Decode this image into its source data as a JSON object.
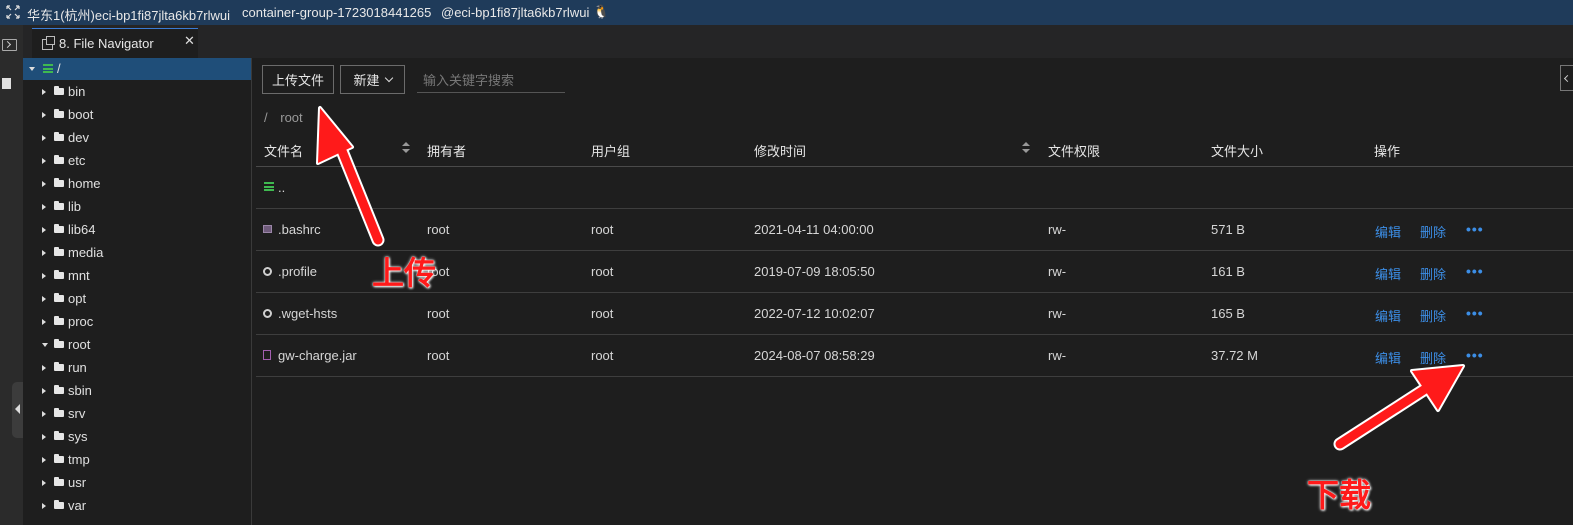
{
  "titlebar": {
    "region": "华东1(杭州)eci-bp1fi87jlta6kb7rlwui",
    "container_group": "container-group-1723018441265",
    "instance": "@eci-bp1fi87jlta6kb7rlwui"
  },
  "tab": {
    "label": "8. File Navigator",
    "close": "✕"
  },
  "tree": {
    "root": "/",
    "items": [
      {
        "name": "bin",
        "open": false
      },
      {
        "name": "boot",
        "open": false
      },
      {
        "name": "dev",
        "open": false
      },
      {
        "name": "etc",
        "open": false
      },
      {
        "name": "home",
        "open": false
      },
      {
        "name": "lib",
        "open": false
      },
      {
        "name": "lib64",
        "open": false
      },
      {
        "name": "media",
        "open": false
      },
      {
        "name": "mnt",
        "open": false
      },
      {
        "name": "opt",
        "open": false
      },
      {
        "name": "proc",
        "open": false
      },
      {
        "name": "root",
        "open": true
      },
      {
        "name": "run",
        "open": false
      },
      {
        "name": "sbin",
        "open": false
      },
      {
        "name": "srv",
        "open": false
      },
      {
        "name": "sys",
        "open": false
      },
      {
        "name": "tmp",
        "open": false
      },
      {
        "name": "usr",
        "open": false
      },
      {
        "name": "var",
        "open": false
      }
    ]
  },
  "toolbar": {
    "upload_label": "上传文件",
    "new_label": "新建",
    "search_placeholder": "输入关键字搜索"
  },
  "breadcrumb": {
    "sep": "/",
    "current": "root"
  },
  "table": {
    "headers": {
      "name": "文件名",
      "owner": "拥有者",
      "group": "用户组",
      "mtime": "修改时间",
      "perm": "文件权限",
      "size": "文件大小",
      "ops": "操作"
    },
    "parent_row": "..",
    "rows": [
      {
        "icon": "terminal-file-icon",
        "name": ".bashrc",
        "owner": "root",
        "group": "root",
        "mtime": "2021-04-11 04:00:00",
        "perm": "rw-",
        "size": "571 B"
      },
      {
        "icon": "gear-file-icon",
        "name": ".profile",
        "owner": "root",
        "group": "root",
        "mtime": "2019-07-09 18:05:50",
        "perm": "rw-",
        "size": "161 B"
      },
      {
        "icon": "gear-file-icon",
        "name": ".wget-hsts",
        "owner": "root",
        "group": "root",
        "mtime": "2022-07-12 10:02:07",
        "perm": "rw-",
        "size": "165 B"
      },
      {
        "icon": "jar-file-icon",
        "name": "gw-charge.jar",
        "owner": "root",
        "group": "root",
        "mtime": "2024-08-07 08:58:29",
        "perm": "rw-",
        "size": "37.72 M"
      }
    ],
    "edit_label": "编辑",
    "delete_label": "删除",
    "more_label": "•••"
  },
  "annotations": {
    "upload": "上传",
    "download": "下载",
    "color": "#ff1a1a"
  }
}
